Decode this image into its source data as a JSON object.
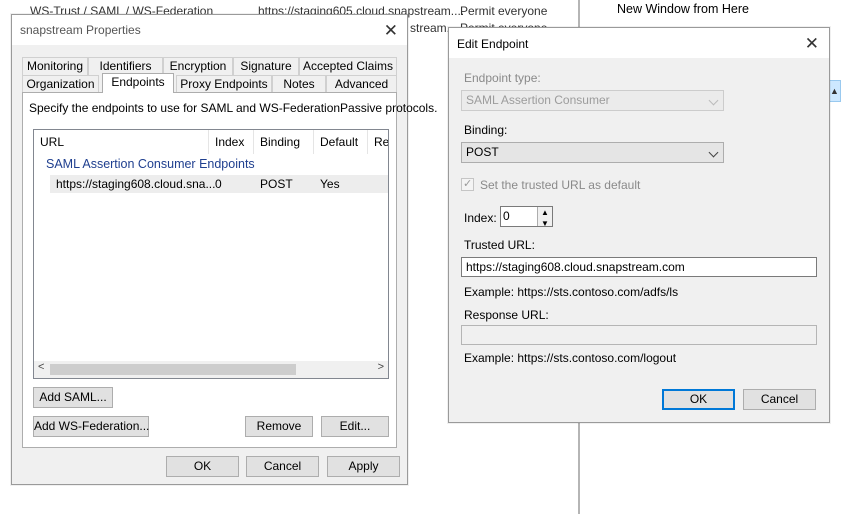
{
  "background": {
    "row1": {
      "name": "WS-Trust / SAML / WS-Federation",
      "identifier": "https://staging605.cloud.snapstream....",
      "policy": "Permit everyone"
    },
    "row2": {
      "identifier": "stream....",
      "policy": "Permit everyone"
    },
    "context_menu_item": "New Window from Here"
  },
  "properties_dialog": {
    "title": "snapstream Properties",
    "tabs_row1": [
      "Monitoring",
      "Identifiers",
      "Encryption",
      "Signature",
      "Accepted Claims"
    ],
    "tabs_row2": [
      "Organization",
      "Endpoints",
      "Proxy Endpoints",
      "Notes",
      "Advanced"
    ],
    "active_tab": "Endpoints",
    "description": "Specify the endpoints to use for SAML and WS-FederationPassive protocols.",
    "list": {
      "columns": [
        "URL",
        "Index",
        "Binding",
        "Default",
        "Re"
      ],
      "group": "SAML Assertion Consumer Endpoints",
      "rows": [
        {
          "url": "https://staging608.cloud.sna...",
          "index": "0",
          "binding": "POST",
          "default": "Yes"
        }
      ]
    },
    "buttons": {
      "add_saml": "Add SAML...",
      "add_wsfed": "Add WS-Federation...",
      "remove": "Remove",
      "edit": "Edit...",
      "ok": "OK",
      "cancel": "Cancel",
      "apply": "Apply"
    }
  },
  "edit_endpoint": {
    "title": "Edit Endpoint",
    "endpoint_type_label": "Endpoint type:",
    "endpoint_type_value": "SAML Assertion Consumer",
    "binding_label": "Binding:",
    "binding_value": "POST",
    "trusted_default_label": "Set the trusted URL as default",
    "trusted_default_checked": true,
    "index_label": "Index:",
    "index_value": "0",
    "trusted_url_label": "Trusted URL:",
    "trusted_url_value": "https://staging608.cloud.snapstream.com",
    "trusted_url_example": "Example: https://sts.contoso.com/adfs/ls",
    "response_url_label": "Response URL:",
    "response_url_value": "",
    "response_url_example": "Example: https://sts.contoso.com/logout",
    "ok": "OK",
    "cancel": "Cancel"
  },
  "colors": {
    "accent": "#0078d7",
    "group_text": "#1f3f8f"
  }
}
